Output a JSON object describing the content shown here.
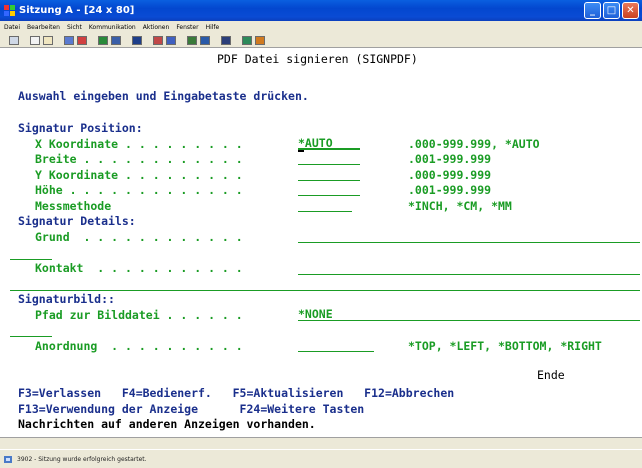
{
  "window": {
    "title": "Sitzung A - [24 x 80]",
    "controls": {
      "minimize": "_",
      "maximize": "□",
      "close": "✕"
    }
  },
  "menu": [
    "Datei",
    "Bearbeiten",
    "Sicht",
    "Kommunikation",
    "Aktionen",
    "Fenster",
    "Hilfe"
  ],
  "toolbar": {
    "icons": [
      "print-screen-icon",
      "copy-icon",
      "paste-icon",
      "send-icon",
      "receive-icon",
      "display-icon",
      "keyboard-icon",
      "color-icon",
      "record-macro-icon",
      "play-macro-icon",
      "stop-macro-icon",
      "help-icon",
      "customize-icon",
      "session-icon"
    ]
  },
  "screen": {
    "title": "PDF Datei signieren (SIGNPDF)",
    "instruction": "Auswahl eingeben und Eingabetaste drücken.",
    "section_position": "Signatur Position:",
    "fields_position": [
      {
        "label": "X Koordinate . . . . . . . . .",
        "value": "*AUTO",
        "hint": ".000-999.999, *AUTO"
      },
      {
        "label": "Breite . . . . . . . . . . . .",
        "value": "",
        "hint": ".001-999.999"
      },
      {
        "label": "Y Koordinate . . . . . . . . .",
        "value": "",
        "hint": ".000-999.999"
      },
      {
        "label": "Höhe . . . . . . . . . . . . .",
        "value": "",
        "hint": ".001-999.999"
      },
      {
        "label": "Messmethode",
        "value": "",
        "hint": "*INCH, *CM, *MM"
      }
    ],
    "section_details": "Signatur Details:",
    "grund_label": "Grund  . . . . . . . . . . . .",
    "grund_value": "",
    "kontakt_label": "Kontakt  . . . . . . . . . . .",
    "kontakt_value": "",
    "section_bild": "Signaturbild::",
    "pfad_label": "Pfad zur Bilddatei . . . . . .",
    "pfad_value": "*NONE",
    "anordnung_label": "Anordnung  . . . . . . . . . .",
    "anordnung_value": "",
    "anordnung_hint": "*TOP, *LEFT, *BOTTOM, *RIGHT",
    "end_marker": "Ende",
    "fkeys_row1": "F3=Verlassen   F4=Bedienerf.   F5=Aktualisieren   F12=Abbrechen",
    "fkeys_row2": "F13=Verwendung der Anzeige      F24=Weitere Tasten",
    "message": "Nachrichten auf anderen Anzeigen vorhanden."
  },
  "status": {
    "text": "3902 - Sitzung wurde erfolgreich gestartet."
  }
}
